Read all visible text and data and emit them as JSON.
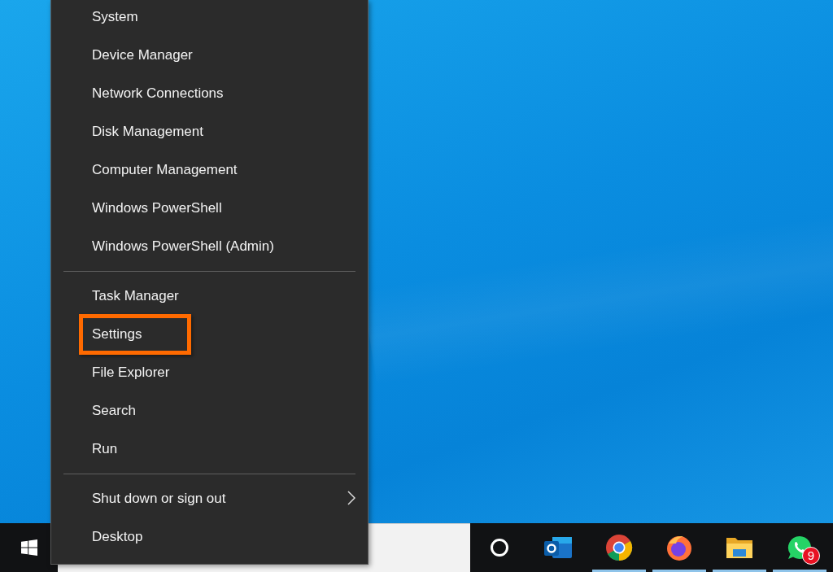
{
  "menu": {
    "groups": [
      {
        "items": [
          {
            "label": "System",
            "highlighted": false,
            "submenu": false
          },
          {
            "label": "Device Manager",
            "highlighted": false,
            "submenu": false
          },
          {
            "label": "Network Connections",
            "highlighted": false,
            "submenu": false
          },
          {
            "label": "Disk Management",
            "highlighted": false,
            "submenu": false
          },
          {
            "label": "Computer Management",
            "highlighted": false,
            "submenu": false
          },
          {
            "label": "Windows PowerShell",
            "highlighted": false,
            "submenu": false
          },
          {
            "label": "Windows PowerShell (Admin)",
            "highlighted": false,
            "submenu": false
          }
        ]
      },
      {
        "items": [
          {
            "label": "Task Manager",
            "highlighted": false,
            "submenu": false
          },
          {
            "label": "Settings",
            "highlighted": true,
            "submenu": false
          },
          {
            "label": "File Explorer",
            "highlighted": false,
            "submenu": false
          },
          {
            "label": "Search",
            "highlighted": false,
            "submenu": false
          },
          {
            "label": "Run",
            "highlighted": false,
            "submenu": false
          }
        ]
      },
      {
        "items": [
          {
            "label": "Shut down or sign out",
            "highlighted": false,
            "submenu": true
          },
          {
            "label": "Desktop",
            "highlighted": false,
            "submenu": false
          }
        ]
      }
    ]
  },
  "taskbar": {
    "apps": [
      {
        "kind": "outlook",
        "running": false
      },
      {
        "kind": "chrome",
        "running": true
      },
      {
        "kind": "firefox",
        "running": true
      },
      {
        "kind": "explorer",
        "running": true
      },
      {
        "kind": "whatsapp",
        "running": true,
        "badge": "9"
      }
    ]
  }
}
